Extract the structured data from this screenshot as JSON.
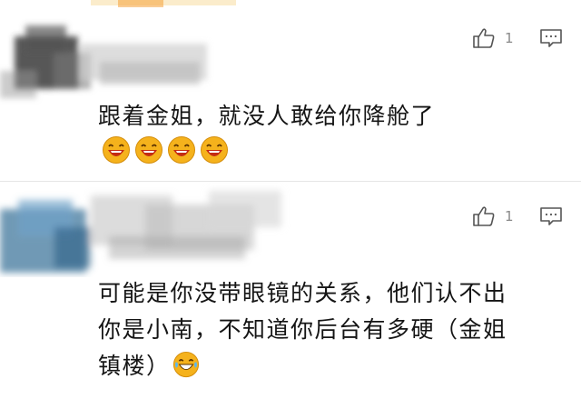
{
  "comments": [
    {
      "id": "c1",
      "likes": "1",
      "text": "跟着金姐，就没人敢给你降舱了",
      "emojis": [
        "laugh-face-icon",
        "laugh-face-icon",
        "laugh-face-icon",
        "laugh-face-icon"
      ]
    },
    {
      "id": "c2",
      "likes": "1",
      "text_lines": [
        "可能是你没带眼镜的关系，他们认不出",
        "你是小南，不知道你后台有多硬（金姐",
        "镇楼）"
      ],
      "emojis": [
        "laugh-cry-icon"
      ]
    }
  ],
  "icons": {
    "like": "thumbs-up-icon",
    "reply": "comment-icon"
  },
  "colors": {
    "background": "#ffffff",
    "divider": "#e6e6e6",
    "count": "#8a8a8a",
    "emoji_face": "#f5b21c"
  }
}
